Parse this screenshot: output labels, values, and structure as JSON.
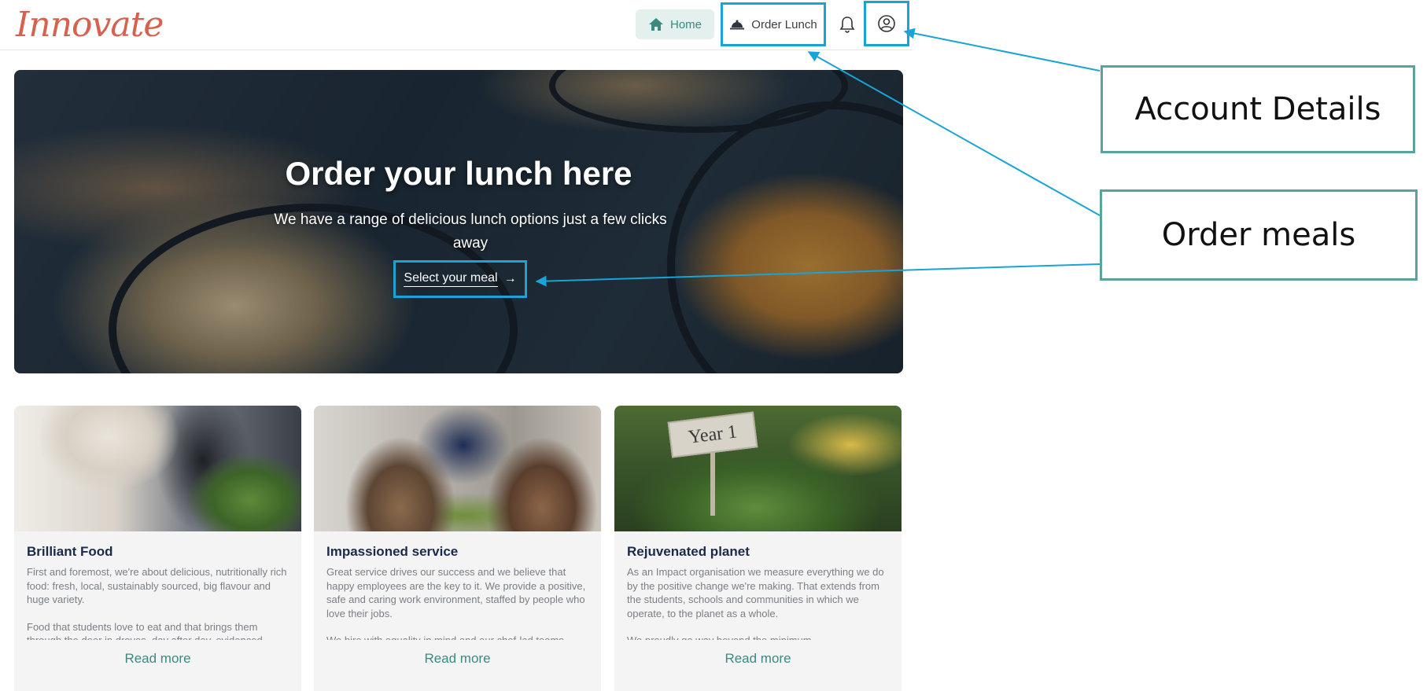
{
  "header": {
    "logo_text": "Innovate",
    "nav": {
      "home_label": "Home",
      "order_lunch_label": "Order Lunch"
    }
  },
  "hero": {
    "title": "Order your lunch here",
    "subtitle": "We have a range of delicious lunch options just a few clicks away",
    "cta_label": "Select your meal",
    "cta_arrow": "→"
  },
  "cards": [
    {
      "title": "Brilliant Food",
      "paragraphs": [
        "First and foremost, we're about delicious, nutritionally rich food: fresh, local, sustainably sourced, big flavour and huge variety.",
        "Food that students love to eat and that brings them through the door in droves, day after day, evidenced"
      ],
      "read_more": "Read more"
    },
    {
      "title": "Impassioned service",
      "paragraphs": [
        "Great service drives our success and we believe that happy employees are the key to it. We provide a positive, safe and caring work environment, staffed by people who love their jobs.",
        "We hire with equality in mind and our chef-led teams"
      ],
      "read_more": "Read more"
    },
    {
      "title": "Rejuvenated planet",
      "sign_text": "Year 1",
      "paragraphs": [
        "As an Impact organisation we measure everything we do by the positive change we're making. That extends from the students, schools and communities in which we operate, to the planet as a whole.",
        "We proudly go way beyond the minimum"
      ],
      "read_more": "Read more"
    }
  ],
  "annotations": {
    "account_details": "Account Details",
    "order_meals": "Order meals"
  },
  "colors": {
    "accent_teal": "#3b8a80",
    "highlight_blue": "#19a3d6",
    "logo_red": "#d6614f",
    "callout_border": "#5aa39c",
    "card_title_navy": "#1c2a4a"
  },
  "icons": {
    "home": "home-icon",
    "order_lunch": "cloche-icon",
    "notifications": "bell-icon",
    "account": "user-circle-icon",
    "cta": "arrow-right-icon"
  }
}
